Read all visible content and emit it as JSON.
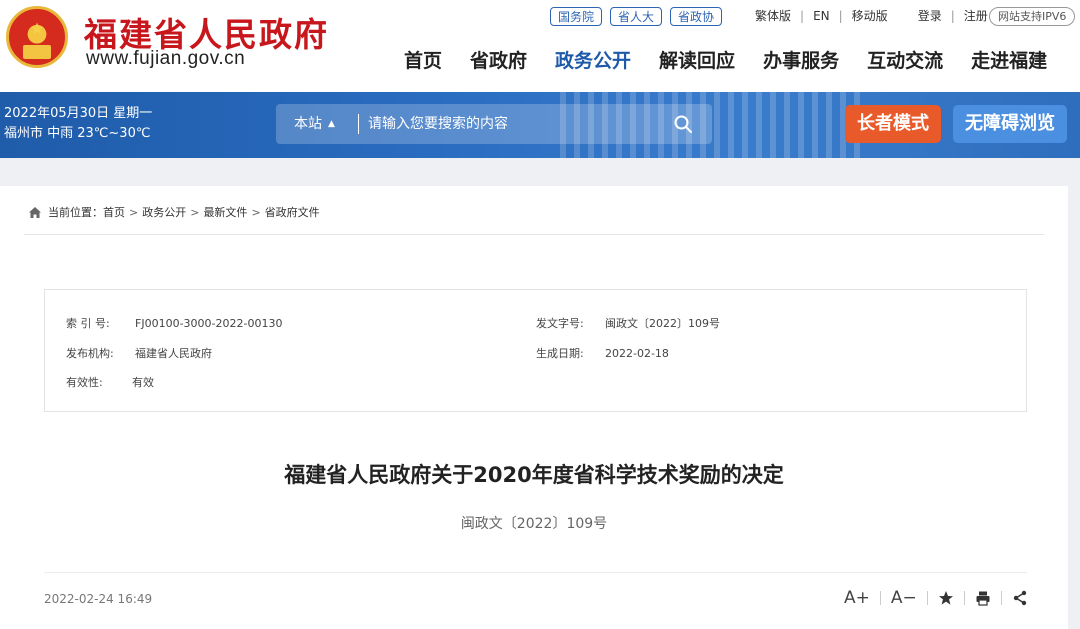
{
  "header": {
    "site_title": "福建省人民政府",
    "site_url": "www.fujian.gov.cn",
    "top_links": [
      "国务院",
      "省人大",
      "省政协"
    ],
    "util_links": [
      "繁体版",
      "EN",
      "移动版"
    ],
    "login": "登录",
    "register": "注册",
    "ipv6": "网站支持IPV6",
    "nav": [
      "首页",
      "省政府",
      "政务公开",
      "解读回应",
      "办事服务",
      "互动交流",
      "走进福建"
    ],
    "nav_active": "政务公开"
  },
  "bar": {
    "date": "2022年05月30日 星期一",
    "weather": "福州市 中雨 23℃~30℃",
    "search_scope": "本站",
    "search_placeholder": "请输入您要搜索的内容",
    "elder_mode": "长者模式",
    "accessible": "无障碍浏览"
  },
  "breadcrumb": {
    "prefix": "当前位置：",
    "items": [
      "首页",
      "政务公开",
      "最新文件",
      "省政府文件"
    ]
  },
  "meta": {
    "index_label": "索 引 号:",
    "index_value": "FJ00100-3000-2022-00130",
    "doc_label": "发文字号:",
    "doc_value": "闽政文〔2022〕109号",
    "org_label": "发布机构:",
    "org_value": "福建省人民政府",
    "date_label": "生成日期:",
    "date_value": "2022-02-18",
    "valid_label": "有效性:",
    "valid_value": "有效"
  },
  "article": {
    "title": "福建省人民政府关于2020年度省科学技术奖励的决定",
    "doc_number": "闽政文〔2022〕109号",
    "publish_time": "2022-02-24 16:49",
    "font_up": "A+",
    "font_down": "A−"
  },
  "colors": {
    "brand_red": "#c8161d",
    "nav_blue": "#1e5aa8",
    "elder_orange": "#e85a2a",
    "access_blue": "#4a8fe0"
  }
}
